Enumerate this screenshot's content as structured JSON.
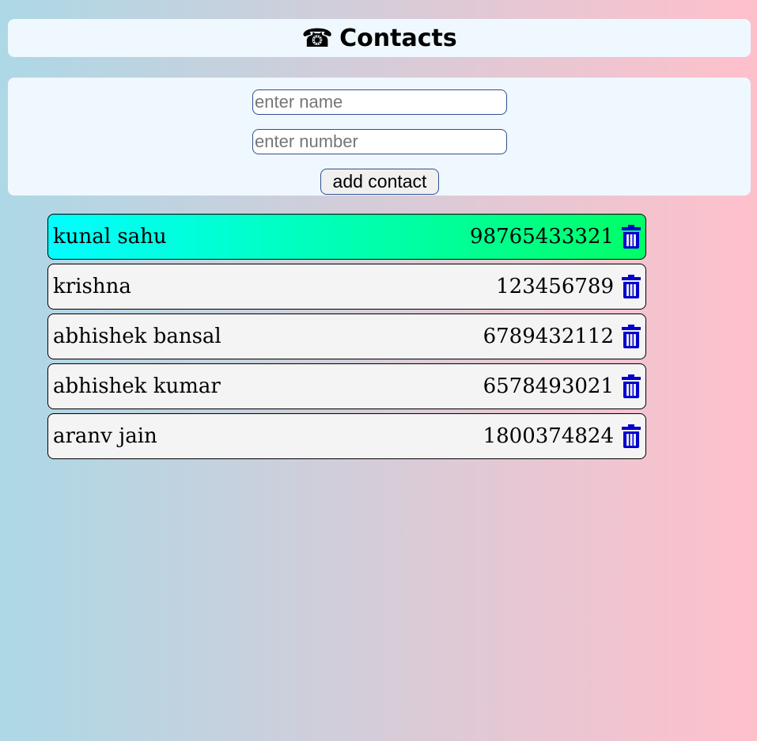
{
  "header": {
    "icon": "phone-icon",
    "icon_glyph": "☎",
    "title": "Contacts"
  },
  "form": {
    "name_placeholder": "enter name",
    "name_value": "",
    "number_placeholder": "enter number",
    "number_value": "",
    "add_button_label": "add contact"
  },
  "contacts": [
    {
      "name": "kunal sahu",
      "number": "98765433321",
      "highlighted": true
    },
    {
      "name": "krishna",
      "number": "123456789",
      "highlighted": false
    },
    {
      "name": "abhishek bansal",
      "number": "6789432112",
      "highlighted": false
    },
    {
      "name": "abhishek kumar",
      "number": "6578493021",
      "highlighted": false
    },
    {
      "name": "aranv jain",
      "number": "1800374824",
      "highlighted": false
    }
  ],
  "colors": {
    "background_left": "#add8e6",
    "background_right": "#ffc0cb",
    "panel": "#f0f8ff",
    "row": "#f4f4f4",
    "highlight_left": "#00ffff",
    "highlight_right": "#00ff66",
    "delete_icon": "#0000cc"
  },
  "delete_icon": "trash-icon"
}
